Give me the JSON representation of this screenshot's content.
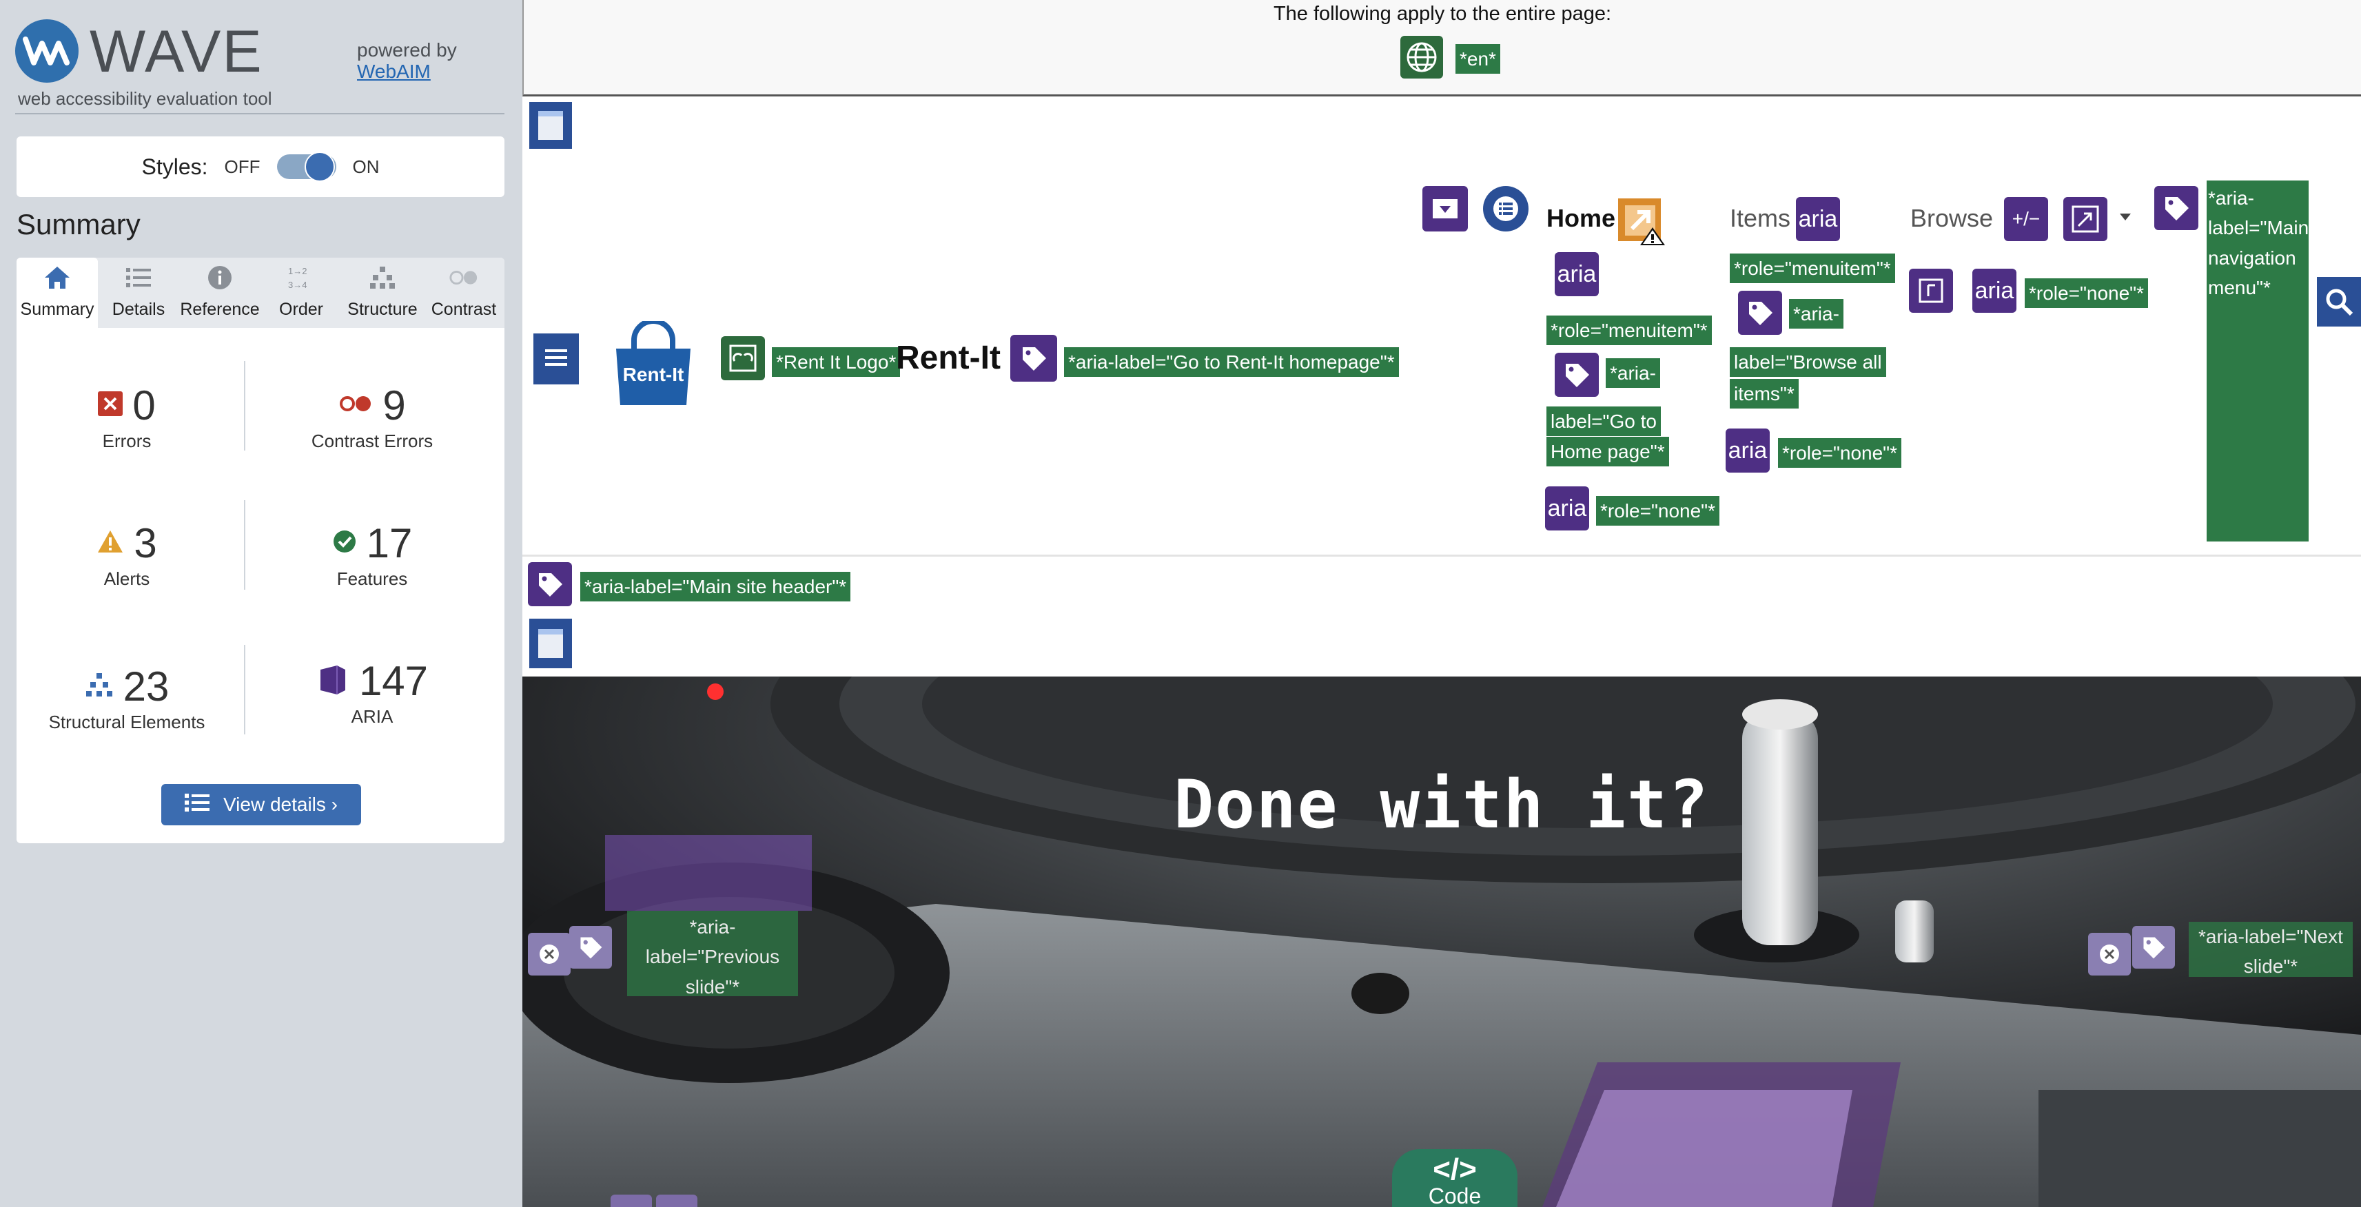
{
  "wave": {
    "name": "WAVE",
    "tagline": "web accessibility evaluation tool",
    "powered_by": "powered by",
    "webaim_link": "WebAIM",
    "styles_label": "Styles:",
    "styles_off": "OFF",
    "styles_on": "ON",
    "styles_enabled": true,
    "summary_title": "Summary",
    "tabs": [
      {
        "label": "Summary",
        "icon": "home-icon",
        "active": true
      },
      {
        "label": "Details",
        "icon": "list-icon",
        "active": false
      },
      {
        "label": "Reference",
        "icon": "info-icon",
        "active": false
      },
      {
        "label": "Order",
        "icon": "order-icon",
        "active": false
      },
      {
        "label": "Structure",
        "icon": "structure-icon",
        "active": false
      },
      {
        "label": "Contrast",
        "icon": "contrast-icon",
        "active": false
      }
    ],
    "stats": {
      "errors": {
        "value": "0",
        "label": "Errors",
        "color": "#c0392b"
      },
      "contrast_errors": {
        "value": "9",
        "label": "Contrast Errors",
        "color": "#c0392b"
      },
      "alerts": {
        "value": "3",
        "label": "Alerts",
        "color": "#e0a030"
      },
      "features": {
        "value": "17",
        "label": "Features",
        "color": "#2d7a46"
      },
      "structural": {
        "value": "23",
        "label": "Structural Elements",
        "color": "#3b6cb0"
      },
      "aria": {
        "value": "147",
        "label": "ARIA",
        "color": "#4e2f84"
      }
    },
    "view_details": "View details ›"
  },
  "page": {
    "applies_text": "The following apply to the entire page:",
    "lang_tag": "*en*",
    "brand_logo_text": "Rent-It",
    "brand_name": "Rent-It",
    "tags": {
      "logo_alt": "*Rent It Logo*",
      "home_aria": "*aria-label=\"Go to Rent-It homepage\"*",
      "role_menuitem_1": "*role=\"menuitem\"*",
      "aria_go_home_1": "*aria-",
      "aria_go_home_2": "label=\"Go to",
      "aria_go_home_3": "Home page\"*",
      "role_none_home": "*role=\"none\"*",
      "role_menuitem_items": "*role=\"menuitem\"*",
      "aria_browse_1": "*aria-",
      "aria_browse_2": "label=\"Browse all",
      "aria_browse_3": "items\"*",
      "role_none_items": "*role=\"none\"*",
      "role_none_browse": "*role=\"none\"*",
      "main_nav_menu": "*aria-label=\"Main navigation menu\"*",
      "main_site_header": "*aria-label=\"Main site header\"*",
      "prev_slide": "*aria-label=\"Previous slide\"*",
      "next_slide": "*aria-label=\"Next slide\"*"
    },
    "icon_aria_text": "aria",
    "nav": {
      "home": "Home",
      "items": "Items",
      "browse": "Browse",
      "expand_symbol": "+/−"
    },
    "hero_title": "Done with it?",
    "code_button": "Code"
  }
}
